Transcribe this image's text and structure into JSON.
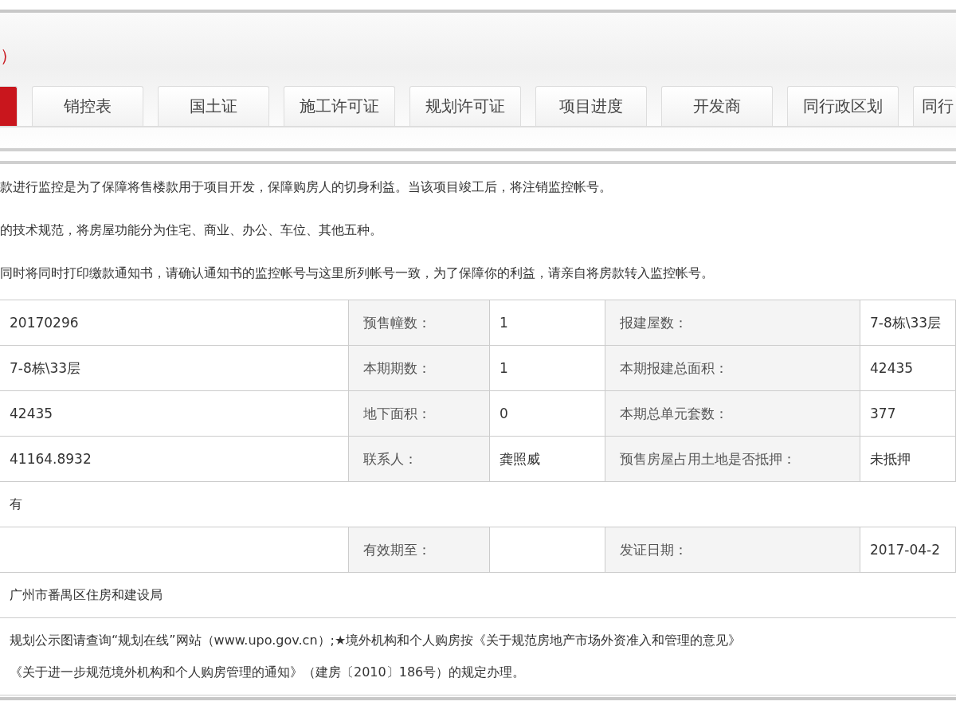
{
  "header": {
    "title_fragment": "）"
  },
  "tabs": [
    {
      "selected": true
    },
    {
      "label": "销控表",
      "selected": false
    },
    {
      "label": "国土证",
      "selected": false
    },
    {
      "label": "施工许可证",
      "selected": false
    },
    {
      "label": "规划许可证",
      "selected": false
    },
    {
      "label": "项目进度",
      "selected": false
    },
    {
      "label": "开发商",
      "selected": false
    },
    {
      "label": "同行政区划",
      "selected": false
    },
    {
      "label": "同行",
      "selected": false
    }
  ],
  "notes": [
    "款进行监控是为了保障将售楼款用于项目开发，保障购房人的切身利益。当该项目竣工后，将注销监控帐号。",
    "的技术规范，将房屋功能分为住宅、商业、办公、车位、其他五种。",
    "同时将同时打印缴款通知书，请确认通知书的监控帐号与这里所列帐号一致，为了保障你的利益，请亲自将房款转入监控帐号。"
  ],
  "table": {
    "rows": [
      {
        "kind": "grid",
        "cells": [
          {
            "kind": "value",
            "text": "20170296"
          },
          {
            "kind": "label",
            "text": "预售幢数："
          },
          {
            "kind": "value",
            "text": "1"
          },
          {
            "kind": "label",
            "text": "报建屋数："
          },
          {
            "kind": "value",
            "text": "7-8栋\\33层"
          }
        ]
      },
      {
        "kind": "grid",
        "cells": [
          {
            "kind": "value",
            "text": "7-8栋\\33层"
          },
          {
            "kind": "label",
            "text": "本期期数："
          },
          {
            "kind": "value",
            "text": "1"
          },
          {
            "kind": "label",
            "text": "本期报建总面积："
          },
          {
            "kind": "value",
            "text": "42435"
          }
        ]
      },
      {
        "kind": "grid",
        "cells": [
          {
            "kind": "value",
            "text": "42435"
          },
          {
            "kind": "label",
            "text": "地下面积："
          },
          {
            "kind": "value",
            "text": "0"
          },
          {
            "kind": "label",
            "text": "本期总单元套数："
          },
          {
            "kind": "value",
            "text": "377"
          }
        ]
      },
      {
        "kind": "grid",
        "cells": [
          {
            "kind": "value",
            "text": "41164.8932"
          },
          {
            "kind": "label",
            "text": "联系人："
          },
          {
            "kind": "value",
            "text": "龚照威"
          },
          {
            "kind": "label",
            "text": "预售房屋占用土地是否抵押："
          },
          {
            "kind": "value",
            "text": "未抵押"
          }
        ]
      },
      {
        "kind": "full",
        "lines": [
          "有"
        ]
      },
      {
        "kind": "grid",
        "cells": [
          {
            "kind": "value"
          },
          {
            "kind": "label",
            "text": "有效期至："
          },
          {
            "kind": "value"
          },
          {
            "kind": "label",
            "text": "发证日期："
          },
          {
            "kind": "value",
            "text": "2017-04-2"
          }
        ]
      },
      {
        "kind": "full",
        "lines": [
          "广州市番禺区住房和建设局"
        ]
      },
      {
        "kind": "full",
        "lines": [
          "规划公示图请查询“规划在线”网站（www.upo.gov.cn）;★境外机构和个人购房按《关于规范房地产市场外资准入和管理的意见》",
          "《关于进一步规范境外机构和个人购房管理的通知》（建房〔2010〕186号）的规定办理。"
        ]
      }
    ]
  }
}
